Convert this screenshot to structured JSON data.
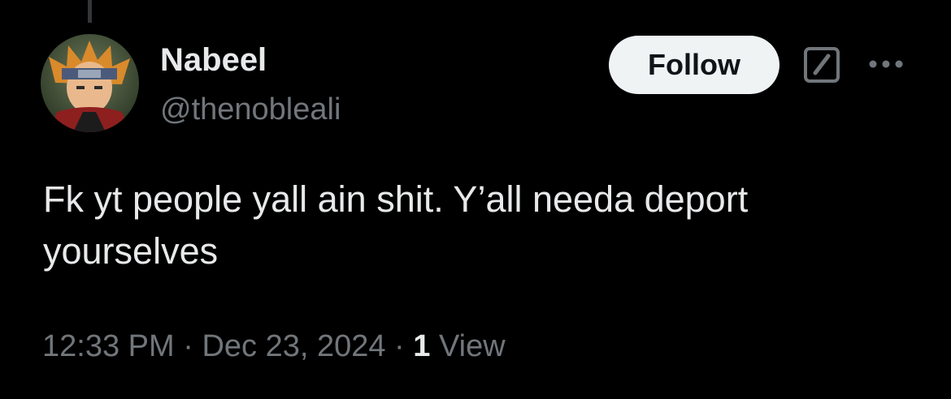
{
  "tweet": {
    "author": {
      "display_name": "Nabeel",
      "handle": "@thenobleali",
      "avatar_icon": "avatar-image"
    },
    "follow_label": "Follow",
    "text": "Fk yt people yall ain shit. Y’all needa deport yourselves",
    "time": "12:33 PM",
    "separator_1": " · ",
    "date": "Dec 23, 2024",
    "separator_2": " · ",
    "views_count": "1",
    "views_label": " View"
  },
  "colors": {
    "background": "#000000",
    "primary_text": "#e7e9ea",
    "secondary_text": "#71767b",
    "follow_button_bg": "#eff3f4",
    "follow_button_text": "#0f1419"
  },
  "icons": {
    "grok": "grok-icon",
    "more": "more-icon"
  }
}
